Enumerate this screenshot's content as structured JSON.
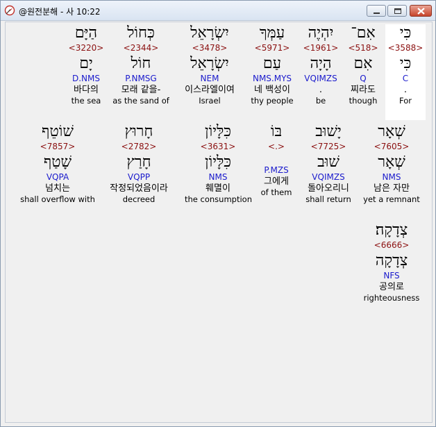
{
  "window": {
    "title": "@원전분해 - 사 10:22",
    "app_icon": "compass-icon",
    "buttons": {
      "minimize": "minimize-icon",
      "maximize": "maximize-icon",
      "close": "close-icon"
    }
  },
  "words": [
    {
      "heb": "כִּי",
      "strong": "<3588>",
      "lemma": "כִּי",
      "morph": "C",
      "kor": ".",
      "eng": "For"
    },
    {
      "heb": "אִם־",
      "strong": "<518>",
      "lemma": "אִם",
      "morph": "Q",
      "kor": "찌라도",
      "eng": "though"
    },
    {
      "heb": "יִהְיֶה",
      "strong": "<1961>",
      "lemma": "הָיָה",
      "morph": "VQIMZS",
      "kor": ".",
      "eng": "be"
    },
    {
      "heb": "עַמְּךָ",
      "strong": "<5971>",
      "lemma": "עַם",
      "morph": "NMS.MYS",
      "kor": "네 백성이",
      "eng": "thy people"
    },
    {
      "heb": "יִשְׂרָאֵל",
      "strong": "<3478>",
      "lemma": "יִשְׂרָאֵל",
      "morph": "NEM",
      "kor": "이스라엘이여",
      "eng": "Israel"
    },
    {
      "heb": "כְּחוֹל",
      "strong": "<2344>",
      "lemma": "חוֹל",
      "morph": "P.NMSG",
      "kor": "모래 같을-",
      "eng": "as the sand of"
    },
    {
      "heb": "הַיָּם",
      "strong": "<3220>",
      "lemma": "יָם",
      "morph": "D.NMS",
      "kor": "바다의",
      "eng": "the sea"
    },
    {
      "heb": "שְׁאָר",
      "strong": "<7605>",
      "lemma": "שְׁאָר",
      "morph": "NMS",
      "kor": "남은 자만",
      "eng": "yet a remnant"
    },
    {
      "heb": "יָשׁוּב",
      "strong": "<7725>",
      "lemma": "שׁוּב",
      "morph": "VQIMZS",
      "kor": "돌아오리니",
      "eng": "shall return"
    },
    {
      "heb": "בּוֹ",
      "strong": "<.>",
      "lemma": "",
      "morph": "P.MZS",
      "kor": "그에게",
      "eng": "of them"
    },
    {
      "heb": "כִּלָּיוֹן",
      "strong": "<3631>",
      "lemma": "כִּלָּיוֹן",
      "morph": "NMS",
      "kor": "훼멸이",
      "eng": "the consumption"
    },
    {
      "heb": "חָרוּץ",
      "strong": "<2782>",
      "lemma": "חָרַץ",
      "morph": "VQPP",
      "kor": "작정되었음이라",
      "eng": "decreed"
    },
    {
      "heb": "שׁוֹטֵף",
      "strong": "<7857>",
      "lemma": "שָׁטַף",
      "morph": "VQPA",
      "kor": "넘치는",
      "eng": "shall overflow with"
    },
    {
      "heb": "צְדָקָה׃",
      "strong": "<6666>",
      "lemma": "צְדָקָה",
      "morph": "NFS",
      "kor": "공의로",
      "eng": "righteousness"
    }
  ]
}
